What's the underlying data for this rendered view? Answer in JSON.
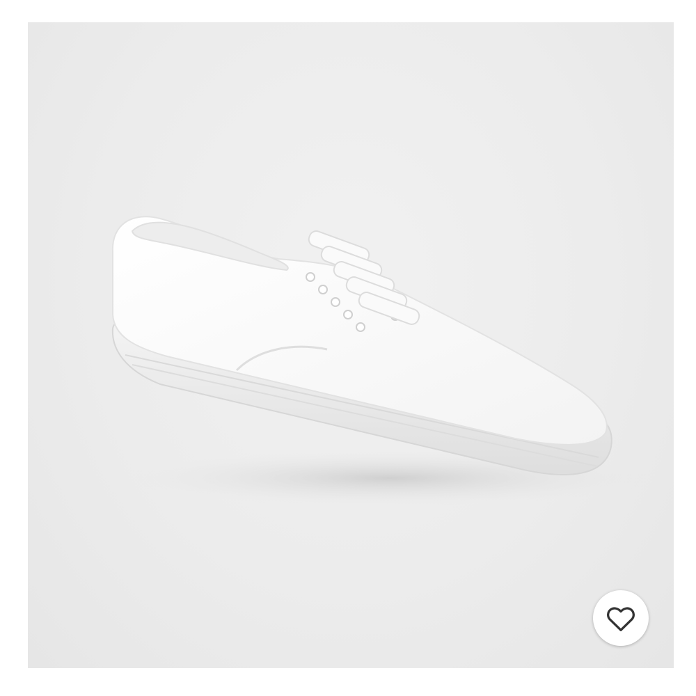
{
  "product": {
    "image_description_icon": "sneaker-image",
    "background_color": "#ececec"
  },
  "favorite": {
    "icon": "heart-outline-icon",
    "color": "#333333"
  }
}
